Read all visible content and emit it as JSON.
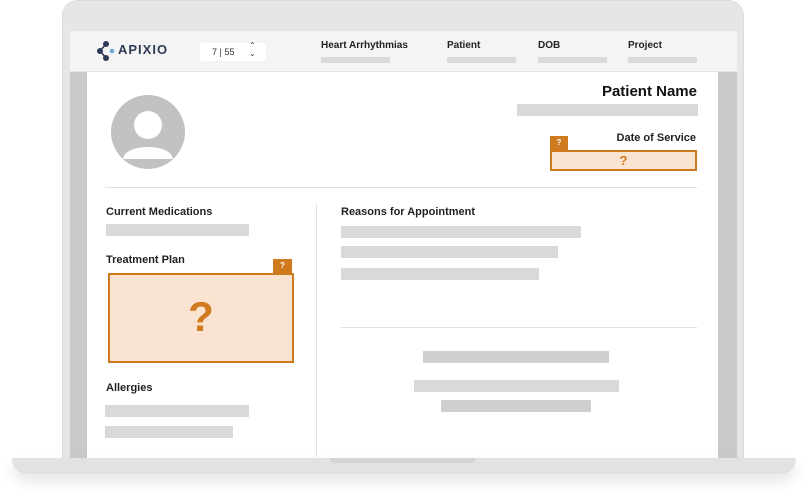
{
  "brand": {
    "name": "APIXIO",
    "accent": "#cf7a1e",
    "logo_color": "#2d3a55"
  },
  "pager": {
    "current": "7",
    "separator": "|",
    "total": "55"
  },
  "header": {
    "columns": [
      {
        "label": "Heart Arrhythmias"
      },
      {
        "label": "Patient"
      },
      {
        "label": "DOB"
      },
      {
        "label": "Project"
      }
    ]
  },
  "patient": {
    "name_label": "Patient Name"
  },
  "date_of_service": {
    "label": "Date of Service",
    "tab": "?",
    "value": "?"
  },
  "sections": {
    "current_medications": "Current Medications",
    "treatment_plan": {
      "label": "Treatment Plan",
      "tab": "?",
      "value": "?"
    },
    "allergies": "Allergies",
    "reasons_for_appointment": "Reasons for Appointment"
  },
  "icons": {
    "avatar": "user-avatar-icon",
    "arrows": "up-down-chevron-icon"
  }
}
